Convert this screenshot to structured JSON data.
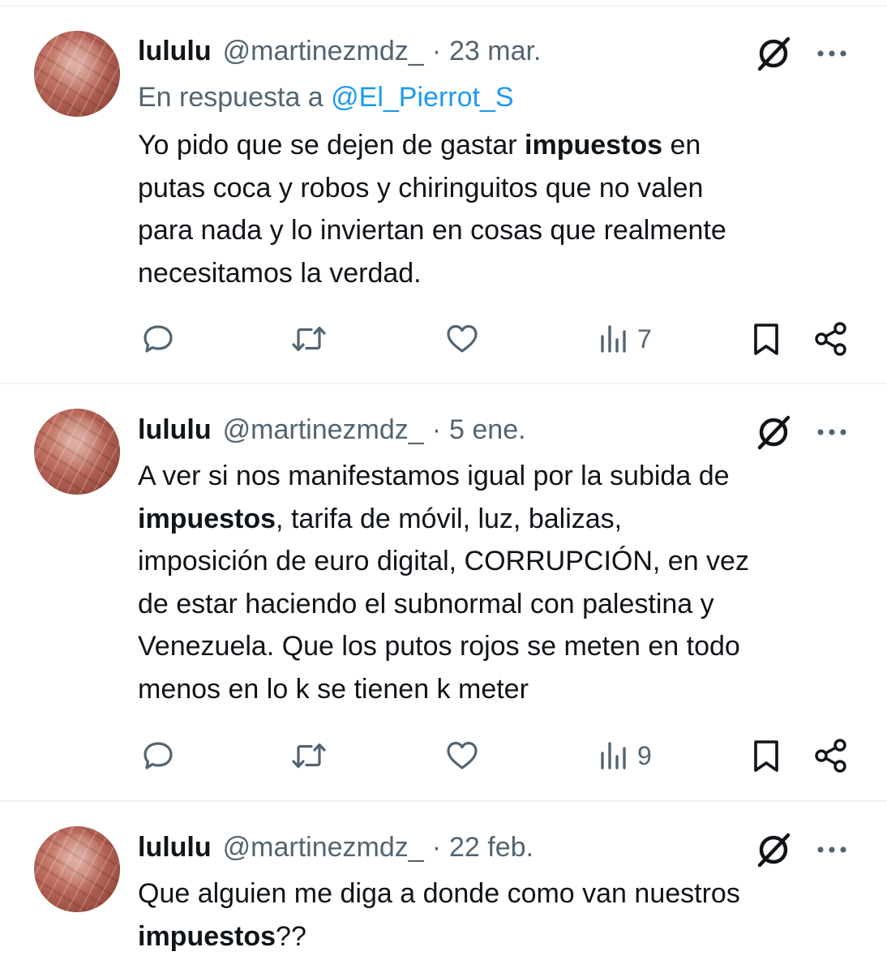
{
  "tweets": [
    {
      "name": "lululu",
      "handle": "@martinezmdz_",
      "separator": "·",
      "date": "23 mar.",
      "reply_prefix": "En respuesta a",
      "reply_mention": "@El_Pierrot_S",
      "lines": [
        [
          {
            "t": "Yo pido que se dejen de gastar "
          },
          {
            "t": "impuestos",
            "b": true
          },
          {
            "t": " en"
          }
        ],
        [
          {
            "t": "putas coca y robos y chiringuitos que no valen"
          }
        ],
        [
          {
            "t": "para nada y lo inviertan en cosas que realmente"
          }
        ],
        [
          {
            "t": "necesitamos la verdad."
          }
        ]
      ],
      "views": "7"
    },
    {
      "name": "lululu",
      "handle": "@martinezmdz_",
      "separator": "·",
      "date": "5 ene.",
      "lines": [
        [
          {
            "t": "A ver si nos manifestamos igual por la subida de"
          }
        ],
        [
          {
            "t": "impuestos",
            "b": true
          },
          {
            "t": ", tarifa de móvil, luz, balizas,"
          }
        ],
        [
          {
            "t": "imposición de euro digital, CORRUPCIÓN, en vez"
          }
        ],
        [
          {
            "t": "de estar haciendo el subnormal con palestina y"
          }
        ],
        [
          {
            "t": "Venezuela. Que los putos rojos se meten en todo"
          }
        ],
        [
          {
            "t": "menos en lo k se tienen k meter"
          }
        ]
      ],
      "views": "9"
    },
    {
      "name": "lululu",
      "handle": "@martinezmdz_",
      "separator": "·",
      "date": "22 feb.",
      "lines": [
        [
          {
            "t": "Que alguien me diga a donde como van nuestros"
          }
        ],
        [
          {
            "t": "impuestos",
            "b": true
          },
          {
            "t": "??"
          }
        ]
      ]
    }
  ],
  "icons": {
    "reply": "reply-icon",
    "retweet": "retweet-icon",
    "like": "heart-icon",
    "views": "views-icon",
    "bookmark": "bookmark-icon",
    "share": "share-icon",
    "grok": "grok-icon",
    "more": "more-icon"
  },
  "colors": {
    "text": "#0f1419",
    "muted": "#536471",
    "link": "#1d9bf0",
    "divider": "#eff3f4"
  }
}
